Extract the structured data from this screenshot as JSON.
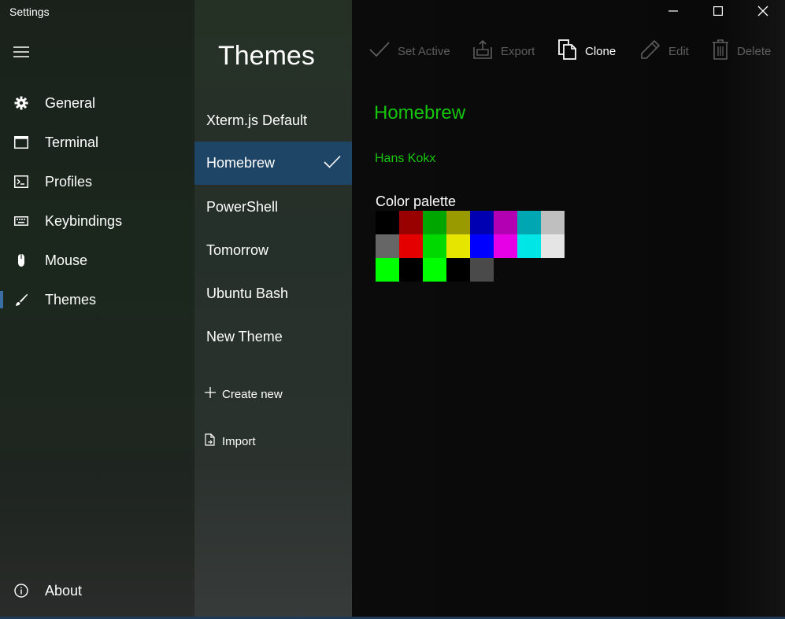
{
  "window": {
    "title": "Settings",
    "minimize_icon": "minimize-icon",
    "maximize_icon": "maximize-icon",
    "close_icon": "close-icon"
  },
  "nav": {
    "menu_icon": "hamburger-icon",
    "items": [
      {
        "label": "General",
        "icon": "gear-icon"
      },
      {
        "label": "Terminal",
        "icon": "window-icon"
      },
      {
        "label": "Profiles",
        "icon": "console-icon"
      },
      {
        "label": "Keybindings",
        "icon": "keyboard-icon"
      },
      {
        "label": "Mouse",
        "icon": "mouse-icon"
      },
      {
        "label": "Themes",
        "icon": "brush-icon",
        "active": true
      }
    ],
    "about": {
      "label": "About",
      "icon": "info-icon"
    }
  },
  "themes_list": {
    "title": "Themes",
    "items": [
      {
        "label": "Xterm.js Default"
      },
      {
        "label": "Homebrew",
        "selected": true
      },
      {
        "label": "PowerShell"
      },
      {
        "label": "Tomorrow"
      },
      {
        "label": "Ubuntu Bash"
      },
      {
        "label": "New Theme"
      }
    ],
    "create_new": {
      "label": "Create new",
      "icon": "plus-icon"
    },
    "import": {
      "label": "Import",
      "icon": "import-file-icon"
    }
  },
  "toolbar": {
    "set_active": {
      "label": "Set Active",
      "icon": "checkmark-icon",
      "enabled": false
    },
    "export": {
      "label": "Export",
      "icon": "export-icon",
      "enabled": false
    },
    "clone": {
      "label": "Clone",
      "icon": "copy-icon",
      "enabled": true
    },
    "edit": {
      "label": "Edit",
      "icon": "pencil-icon",
      "enabled": false
    },
    "delete": {
      "label": "Delete",
      "icon": "trash-icon",
      "enabled": false
    }
  },
  "theme": {
    "name": "Homebrew",
    "author": "Hans Kokx",
    "accent_color": "#16c60c",
    "palette_label": "Color palette",
    "palette_rows": [
      [
        "#000000",
        "#990000",
        "#00a600",
        "#999900",
        "#0000b2",
        "#b200b2",
        "#00a6b2",
        "#bfbfbf"
      ],
      [
        "#666666",
        "#e50000",
        "#00d900",
        "#e5e500",
        "#0000ff",
        "#e500e5",
        "#00e5e5",
        "#e5e5e5"
      ],
      [
        "#00ff00",
        "#000000",
        "#00ff00",
        "#000000",
        "#4a4a4a"
      ]
    ]
  },
  "colors": {
    "selection": "#1f4566",
    "active_indicator": "#3b6ea5",
    "disabled_text": "#5e5e5e"
  }
}
